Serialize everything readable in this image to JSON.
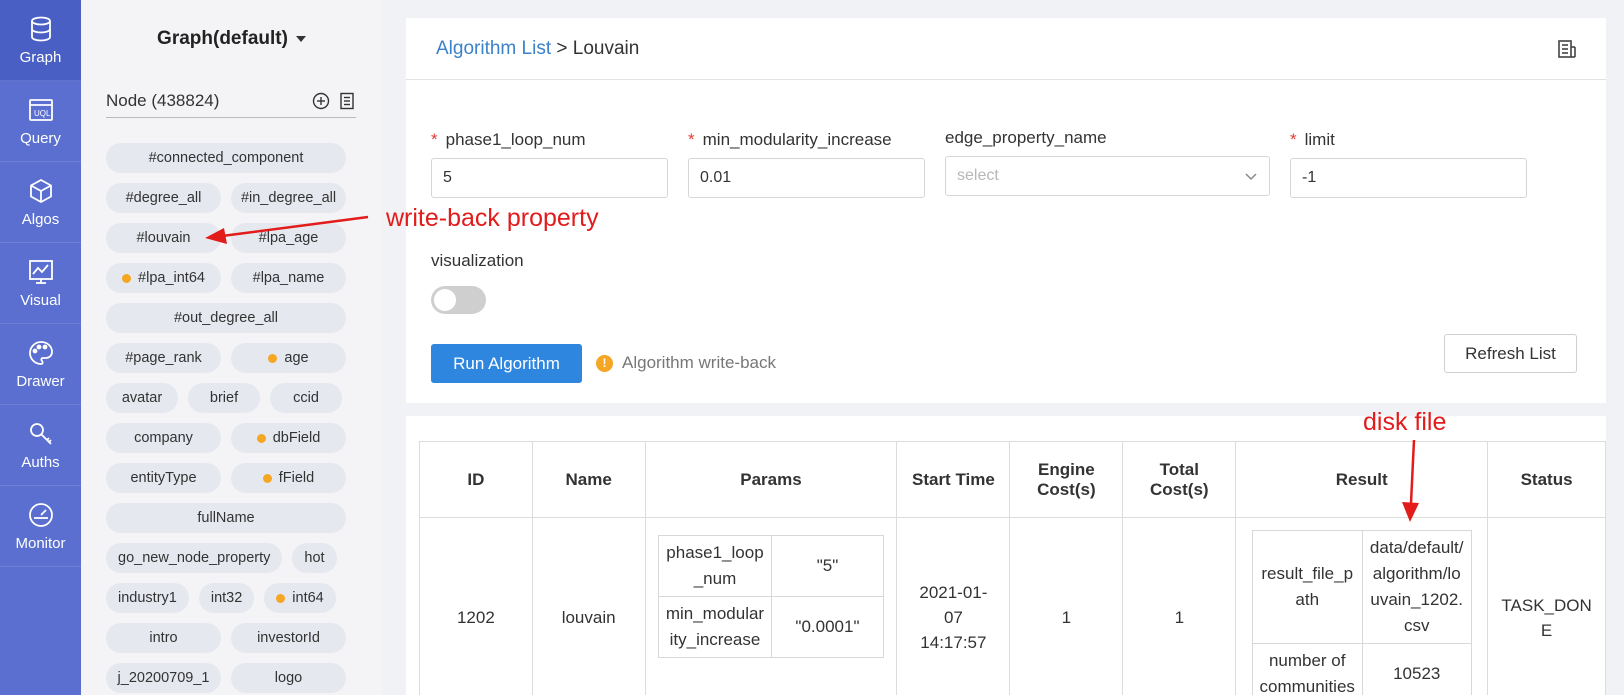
{
  "nav": [
    {
      "label": "Graph",
      "icon": "database-icon"
    },
    {
      "label": "Query",
      "icon": "uql-icon"
    },
    {
      "label": "Algos",
      "icon": "cube-icon"
    },
    {
      "label": "Visual",
      "icon": "chart-icon"
    },
    {
      "label": "Drawer",
      "icon": "palette-icon"
    },
    {
      "label": "Auths",
      "icon": "key-icon"
    },
    {
      "label": "Monitor",
      "icon": "gauge-icon"
    }
  ],
  "sidebar": {
    "graph_title": "Graph(default)",
    "node_label": "Node (438824)",
    "tags": [
      {
        "label": "#connected_component",
        "dot": false,
        "size": "full"
      },
      {
        "label": "#degree_all",
        "dot": false,
        "size": "half"
      },
      {
        "label": "#in_degree_all",
        "dot": false,
        "size": "half"
      },
      {
        "label": "#louvain",
        "dot": false,
        "size": "half"
      },
      {
        "label": "#lpa_age",
        "dot": false,
        "size": "half"
      },
      {
        "label": "#lpa_int64",
        "dot": true,
        "size": "half"
      },
      {
        "label": "#lpa_name",
        "dot": false,
        "size": "half"
      },
      {
        "label": "#out_degree_all",
        "dot": false,
        "size": "full"
      },
      {
        "label": "#page_rank",
        "dot": false,
        "size": "half"
      },
      {
        "label": "age",
        "dot": true,
        "size": "half"
      },
      {
        "label": "avatar",
        "dot": false,
        "size": "third"
      },
      {
        "label": "brief",
        "dot": false,
        "size": "third"
      },
      {
        "label": "ccid",
        "dot": false,
        "size": "third"
      },
      {
        "label": "company",
        "dot": false,
        "size": "half"
      },
      {
        "label": "dbField",
        "dot": true,
        "size": "half"
      },
      {
        "label": "entityType",
        "dot": false,
        "size": "half"
      },
      {
        "label": "fField",
        "dot": true,
        "size": "half"
      },
      {
        "label": "fullName",
        "dot": false,
        "size": "full"
      },
      {
        "label": "go_new_node_property",
        "dot": false,
        "size": "auto"
      },
      {
        "label": "hot",
        "dot": false,
        "size": "auto"
      },
      {
        "label": "industry1",
        "dot": false,
        "size": "auto"
      },
      {
        "label": "int32",
        "dot": false,
        "size": "auto"
      },
      {
        "label": "int64",
        "dot": true,
        "size": "auto"
      },
      {
        "label": "intro",
        "dot": false,
        "size": "half"
      },
      {
        "label": "investorId",
        "dot": false,
        "size": "half"
      },
      {
        "label": "j_20200709_1",
        "dot": false,
        "size": "half"
      },
      {
        "label": "logo",
        "dot": false,
        "size": "half"
      }
    ]
  },
  "breadcrumb": {
    "link": "Algorithm List",
    "separator": " > ",
    "current": "Louvain"
  },
  "form": {
    "phase1_loop_num": {
      "label": "phase1_loop_num",
      "value": "5"
    },
    "min_modularity_increase": {
      "label": "min_modularity_increase",
      "value": "0.01"
    },
    "edge_property_name": {
      "label": "edge_property_name",
      "placeholder": "select"
    },
    "limit": {
      "label": "limit",
      "value": "-1"
    },
    "visualization_label": "visualization"
  },
  "buttons": {
    "run": "Run Algorithm",
    "refresh": "Refresh List"
  },
  "warning_text": "Algorithm write-back",
  "table": {
    "headers": [
      "ID",
      "Name",
      "Params",
      "Start Time",
      "Engine Cost(s)",
      "Total Cost(s)",
      "Result",
      "Status"
    ],
    "row": {
      "id": "1202",
      "name": "louvain",
      "params": [
        {
          "key": "phase1_loop_num",
          "value": "\"5\""
        },
        {
          "key": "min_modularity_increase",
          "value": "\"0.0001\""
        }
      ],
      "start_time": "2021-01-07 14:17:57",
      "engine_cost": "1",
      "total_cost": "1",
      "result": [
        {
          "key": "result_file_path",
          "value": "data/default/algorithm/louvain_1202.csv"
        },
        {
          "key": "number of communities",
          "value": "10523"
        }
      ],
      "status": "TASK_DONE"
    }
  },
  "annotations": {
    "write_back": "write-back property",
    "disk_file": "disk file"
  },
  "colors": {
    "nav_bg": "#5a6fcf",
    "primary": "#2e86de",
    "link": "#3b82c9",
    "annotation": "#e21b1b",
    "dot": "#f5a623"
  }
}
